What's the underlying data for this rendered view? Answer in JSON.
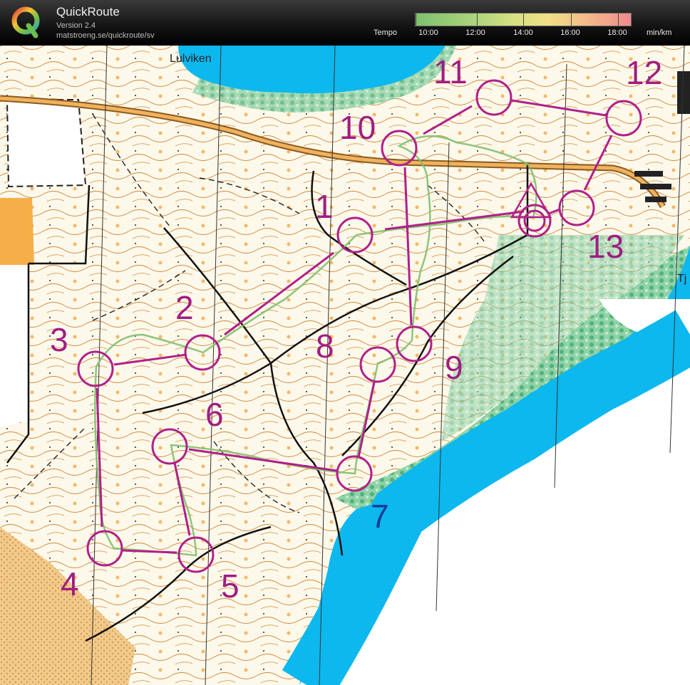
{
  "app": {
    "title": "QuickRoute",
    "version": "Version 2.4",
    "url": "matstroeng.se/quickroute/sv"
  },
  "legend": {
    "label": "Tempo",
    "unit": "min/km",
    "ticks": [
      "10:00",
      "12:00",
      "14:00",
      "16:00",
      "18:00"
    ],
    "colors": [
      "#7fc06e",
      "#a7d27a",
      "#d5e081",
      "#f1df86",
      "#f3b988",
      "#f08a8e"
    ]
  },
  "map": {
    "place_names": [
      "Lulviken",
      "Tj"
    ],
    "controls": [
      {
        "number": "1"
      },
      {
        "number": "2"
      },
      {
        "number": "3"
      },
      {
        "number": "4"
      },
      {
        "number": "5"
      },
      {
        "number": "6"
      },
      {
        "number": "7"
      },
      {
        "number": "8"
      },
      {
        "number": "9"
      },
      {
        "number": "10"
      },
      {
        "number": "11"
      },
      {
        "number": "12"
      },
      {
        "number": "13"
      }
    ],
    "colors": {
      "water": "#0cb8ee",
      "forest": "#fdfbf2",
      "contour": "#c9772b",
      "course": "#b0208a",
      "vegetation": "#6cc392",
      "open_land": "#f5b35c"
    }
  }
}
